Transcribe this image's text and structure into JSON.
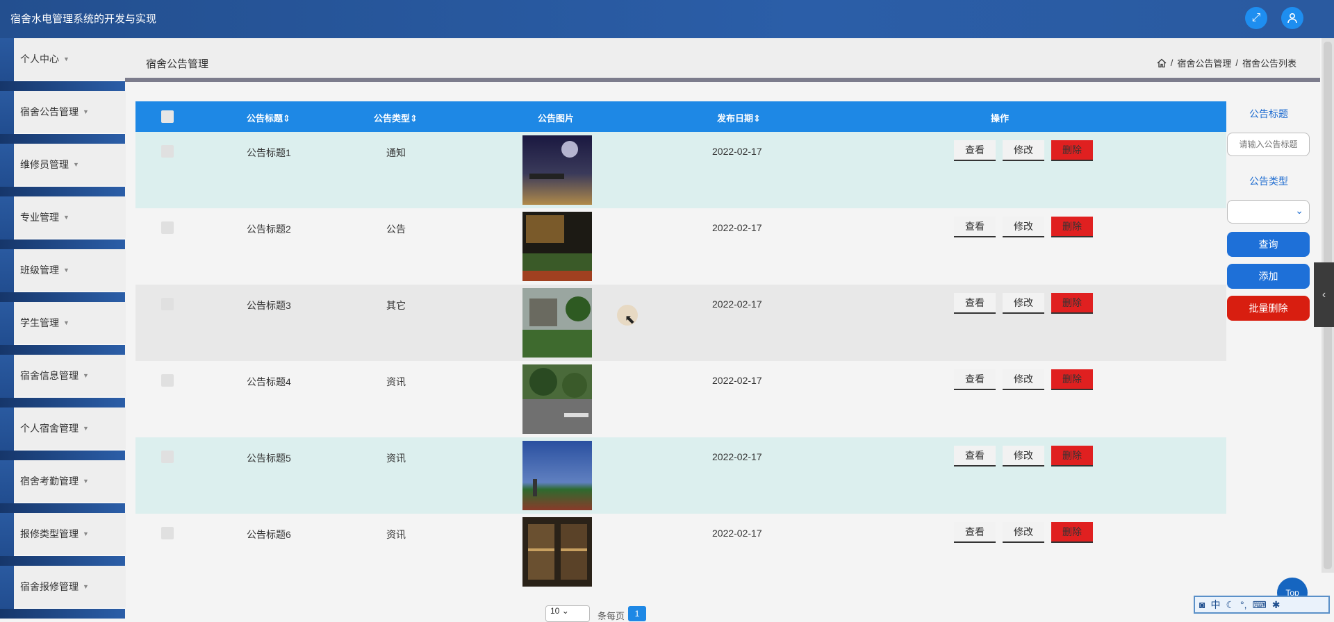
{
  "app": {
    "title": "宿舍水电管理系统的开发与实现"
  },
  "header": {
    "icons": [
      "fullscreen-icon",
      "user-icon"
    ]
  },
  "sidebar": {
    "items": [
      {
        "label": "个人中心"
      },
      {
        "label": "宿舍公告管理"
      },
      {
        "label": "维修员管理"
      },
      {
        "label": "专业管理"
      },
      {
        "label": "班级管理"
      },
      {
        "label": "学生管理"
      },
      {
        "label": "宿舍信息管理"
      },
      {
        "label": "个人宿舍管理"
      },
      {
        "label": "宿舍考勤管理"
      },
      {
        "label": "报修类型管理"
      },
      {
        "label": "宿舍报修管理"
      }
    ]
  },
  "page": {
    "title": "宿舍公告管理",
    "breadcrumb": {
      "section": "宿舍公告管理",
      "current": "宿舍公告列表",
      "sep": "/"
    }
  },
  "table": {
    "headers": {
      "title": "公告标题",
      "type": "公告类型",
      "image": "公告图片",
      "date": "发布日期",
      "actions": "操作"
    },
    "sort_icon": "⇕",
    "actions": {
      "view": "查看",
      "edit": "修改",
      "delete": "删除"
    },
    "rows": [
      {
        "title": "公告标题1",
        "type": "通知",
        "date": "2022-02-17"
      },
      {
        "title": "公告标题2",
        "type": "公告",
        "date": "2022-02-17"
      },
      {
        "title": "公告标题3",
        "type": "其它",
        "date": "2022-02-17"
      },
      {
        "title": "公告标题4",
        "type": "资讯",
        "date": "2022-02-17"
      },
      {
        "title": "公告标题5",
        "type": "资讯",
        "date": "2022-02-17"
      },
      {
        "title": "公告标题6",
        "type": "资讯",
        "date": "2022-02-17"
      }
    ]
  },
  "search": {
    "title_label": "公告标题",
    "title_placeholder": "请输入公告标题",
    "type_label": "公告类型",
    "type_value": "",
    "query_button": "查询",
    "add_button": "添加",
    "batch_delete_button": "批量删除"
  },
  "pagination": {
    "page_size": "10",
    "per_page_text": "条每页",
    "current_page": "1"
  },
  "misc": {
    "top_label": "Top",
    "ime_label": "中"
  },
  "colors": {
    "primary": "#1e88e5",
    "danger": "#e02020",
    "topbar": "#2b5ea8"
  }
}
